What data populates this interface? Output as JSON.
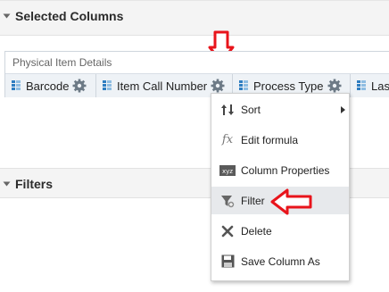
{
  "selected_columns": {
    "title": "Selected Columns"
  },
  "group": {
    "label": "Physical Item Details",
    "columns": [
      {
        "label": "Barcode"
      },
      {
        "label": "Item Call Number"
      },
      {
        "label": "Process Type"
      },
      {
        "label": "Las"
      }
    ]
  },
  "context_menu": {
    "items": [
      {
        "label": "Sort",
        "icon": "sort-icon"
      },
      {
        "label": "Edit formula",
        "icon": "fx-icon"
      },
      {
        "label": "Column Properties",
        "icon": "column-properties-icon"
      },
      {
        "label": "Filter",
        "icon": "filter-icon"
      },
      {
        "label": "Delete",
        "icon": "delete-x-icon"
      },
      {
        "label": "Save Column As",
        "icon": "save-icon"
      }
    ]
  },
  "filters": {
    "title": "Filters"
  },
  "colors": {
    "annotation_red": "#e8141b",
    "accent_blue": "#2f7ec1",
    "menu_highlight": "#e7e9ec"
  }
}
